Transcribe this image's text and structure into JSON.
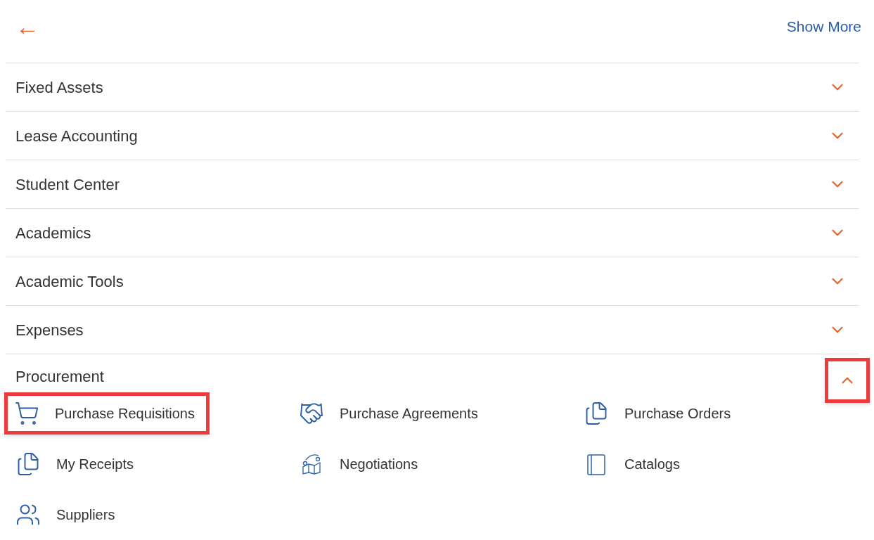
{
  "header": {
    "back": "←",
    "link": "Show More"
  },
  "sections": [
    {
      "title": "Fixed Assets",
      "expanded": false,
      "highlighted": false
    },
    {
      "title": "Lease Accounting",
      "expanded": false,
      "highlighted": false
    },
    {
      "title": "Student Center",
      "expanded": false,
      "highlighted": false
    },
    {
      "title": "Academics",
      "expanded": false,
      "highlighted": false
    },
    {
      "title": "Academic Tools",
      "expanded": false,
      "highlighted": false
    },
    {
      "title": "Expenses",
      "expanded": false,
      "highlighted": false
    },
    {
      "title": "Procurement",
      "expanded": true,
      "highlighted": true,
      "items": [
        {
          "label": "Purchase Requisitions",
          "kind": "cart",
          "highlighted": true
        },
        {
          "label": "Purchase Agreements",
          "kind": "handshake",
          "highlighted": false
        },
        {
          "label": "Purchase Orders",
          "kind": "documents",
          "highlighted": false
        },
        {
          "label": "My Receipts",
          "kind": "documents",
          "highlighted": false
        },
        {
          "label": "Negotiations",
          "kind": "negotiation",
          "highlighted": false
        },
        {
          "label": "Catalogs",
          "kind": "catalog",
          "highlighted": false
        },
        {
          "label": "Suppliers",
          "kind": "people",
          "highlighted": false
        }
      ]
    }
  ]
}
